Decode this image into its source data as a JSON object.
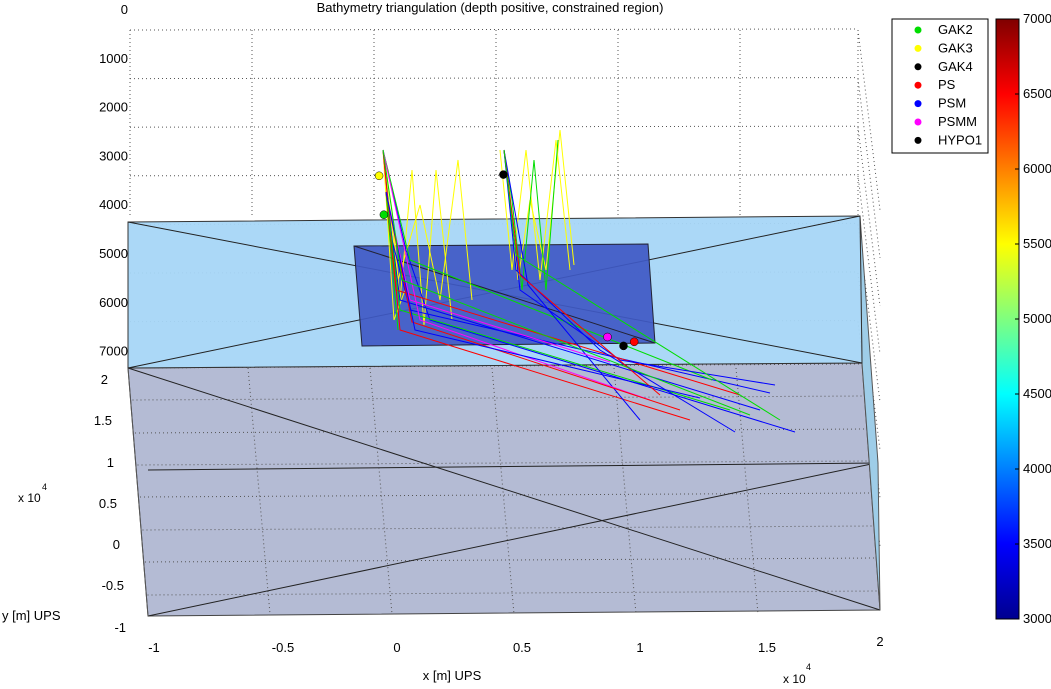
{
  "chart_data": {
    "type": "scatter",
    "title": "Bathymetry triangulation (depth positive, constrained region)",
    "xlabel": "x [m] UPS",
    "ylabel": "y [m] UPS",
    "x_exponent": "x 10",
    "x_exponent_power": "4",
    "y_exponent": "x 10",
    "y_exponent_power": "4",
    "x_ticks": [
      "-1",
      "-0.5",
      "0",
      "0.5",
      "1",
      "1.5",
      "2"
    ],
    "y_ticks": [
      "2",
      "1.5",
      "1",
      "0.5",
      "0",
      "-0.5",
      "-1"
    ],
    "z_ticks": [
      "0",
      "1000",
      "2000",
      "3000",
      "4000",
      "5000",
      "6000",
      "7000"
    ],
    "xlim": [
      -10000,
      20000
    ],
    "ylim": [
      -10000,
      20000
    ],
    "zlim": [
      0,
      7000
    ],
    "colorbar": {
      "range": [
        3000,
        7000
      ],
      "ticks": [
        "7000",
        "6500",
        "6000",
        "5500",
        "5000",
        "4500",
        "4000",
        "3500",
        "3000"
      ],
      "colormap": "jet"
    },
    "legend": {
      "placement": "top-right",
      "entries": [
        {
          "label": "GAK2",
          "color": "#00dd00"
        },
        {
          "label": "GAK3",
          "color": "#ffff00"
        },
        {
          "label": "GAK4",
          "color": "#000000"
        },
        {
          "label": "PS",
          "color": "#ff0000"
        },
        {
          "label": "PSM",
          "color": "#0000ff"
        },
        {
          "label": "PSMM",
          "color": "#ff00ff"
        },
        {
          "label": "HYPO1",
          "color": "#000000"
        }
      ]
    },
    "stations": [
      {
        "name": "GAK3",
        "x": -700,
        "y": 5000,
        "depth": 3000,
        "color": "#ffff00"
      },
      {
        "name": "GAK2",
        "x": -500,
        "y": 5000,
        "depth": 3800,
        "color": "#00dd00"
      },
      {
        "name": "GAK4",
        "x": 4500,
        "y": 8000,
        "depth": 3000,
        "color": "#000000"
      },
      {
        "name": "HYPO1",
        "x": 9400,
        "y": 5000,
        "depth": 6500,
        "color": "#000000"
      },
      {
        "name": "PSMM",
        "x": 8700,
        "y": 3000,
        "depth": 6300,
        "color": "#ff00ff"
      },
      {
        "name": "PS",
        "x": 9800,
        "y": 3000,
        "depth": 6400,
        "color": "#ff0000"
      }
    ],
    "grid": true
  }
}
